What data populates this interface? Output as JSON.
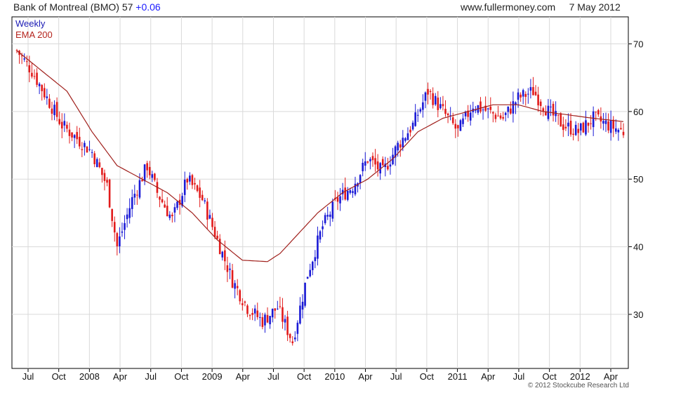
{
  "header": {
    "title": "Bank of Montreal (BMO) 57",
    "change": "+0.06",
    "source": "www.fullermoney.com",
    "date": "7 May 2012"
  },
  "legend": {
    "series_label": "Weekly",
    "ema_label": "EMA 200"
  },
  "copyright": "© 2012 Stockcube Research Ltd",
  "colors": {
    "up": "#1a1ad6",
    "down": "#e21b1b",
    "ema": "#a0201c",
    "grid": "#d9d9d9",
    "axis": "#000000"
  },
  "chart_data": {
    "type": "line",
    "title": "Bank of Montreal (BMO) 57",
    "ylim": [
      22,
      74
    ],
    "yticks": [
      30,
      40,
      50,
      60,
      70
    ],
    "grid": true,
    "legend_position": "top-left",
    "x_labels": [
      "Jul",
      "Oct",
      "2008",
      "Apr",
      "Jul",
      "Oct",
      "2009",
      "Apr",
      "Jul",
      "Oct",
      "2010",
      "Apr",
      "Jul",
      "Oct",
      "2011",
      "Apr",
      "Jul",
      "Oct",
      "2012",
      "Apr"
    ],
    "series": [
      {
        "name": "Weekly",
        "x": [
          0,
          6,
          12,
          18,
          24,
          30,
          36,
          40,
          46,
          52,
          56,
          62,
          68,
          74,
          80,
          86,
          92,
          98,
          104,
          110,
          116,
          122,
          128,
          134,
          140,
          146,
          152,
          158,
          164,
          170,
          176,
          182,
          188,
          194,
          200,
          206,
          212,
          218,
          224,
          230,
          236,
          242
        ],
        "values": [
          69,
          66,
          62,
          58,
          56,
          54,
          49,
          40,
          47,
          52,
          48,
          44,
          50,
          47,
          41,
          35,
          31,
          29,
          31,
          26,
          36,
          43,
          47,
          49,
          53,
          51,
          55,
          58,
          63,
          60,
          57,
          61,
          60,
          59,
          62,
          63,
          60,
          58,
          57,
          59,
          58,
          57
        ]
      },
      {
        "name": "EMA 200",
        "x": [
          0,
          10,
          20,
          30,
          40,
          50,
          60,
          70,
          80,
          90,
          100,
          105,
          110,
          120,
          130,
          140,
          150,
          160,
          170,
          180,
          190,
          200,
          210,
          220,
          230,
          242
        ],
        "values": [
          69,
          66,
          63,
          57,
          52,
          50,
          48,
          45,
          41,
          38,
          37.8,
          39,
          41,
          45,
          48,
          50,
          53,
          57,
          59,
          60,
          61,
          61,
          60,
          59.5,
          59,
          58.5
        ]
      }
    ]
  }
}
